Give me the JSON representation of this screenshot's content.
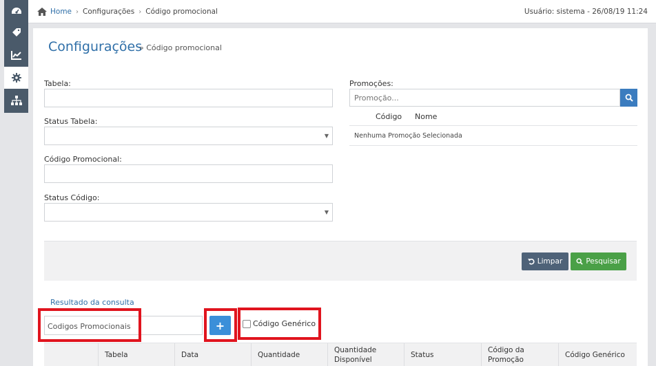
{
  "sidebar": {
    "items": [
      {
        "icon": "dashboard-icon"
      },
      {
        "icon": "tag-icon"
      },
      {
        "icon": "chart-icon"
      },
      {
        "icon": "gear-icon",
        "active": true
      },
      {
        "icon": "sitemap-icon"
      }
    ]
  },
  "header": {
    "breadcrumb": {
      "home": "Home",
      "level1": "Configurações",
      "level2": "Código promocional"
    },
    "user_info": "Usuário: sistema - 26/08/19 11:24"
  },
  "page": {
    "title": "Configurações",
    "subtitle": "» Código promocional"
  },
  "form": {
    "tabela_label": "Tabela:",
    "tabela_value": "",
    "status_tabela_label": "Status Tabela:",
    "status_tabela_value": "",
    "codigo_promocional_label": "Código Promocional:",
    "codigo_promocional_value": "",
    "status_codigo_label": "Status Código:",
    "status_codigo_value": ""
  },
  "promocoes": {
    "label": "Promoções:",
    "placeholder": "Promoção...",
    "columns": [
      "Código",
      "Nome"
    ],
    "empty_text": "Nenhuma Promoção Selecionada"
  },
  "actions": {
    "limpar_label": "Limpar",
    "pesquisar_label": "Pesquisar"
  },
  "results": {
    "title": "Resultado da consulta",
    "codes_input_value": "Codigos Promocionais",
    "add_label": "+",
    "generic_checkbox_label": "Código Genérico",
    "generic_checked": false,
    "columns": [
      "Tabela",
      "Data",
      "Quantidade",
      "Quantidade Disponível",
      "Status",
      "Código da Promoção",
      "Código Genérico"
    ]
  },
  "colors": {
    "accent": "#2f6fa8",
    "sidebar": "#4a5a6a",
    "limpar": "#4e6278",
    "pesquisar": "#4aa047",
    "add_button": "#3b8fd9",
    "highlight": "#e0141e"
  }
}
